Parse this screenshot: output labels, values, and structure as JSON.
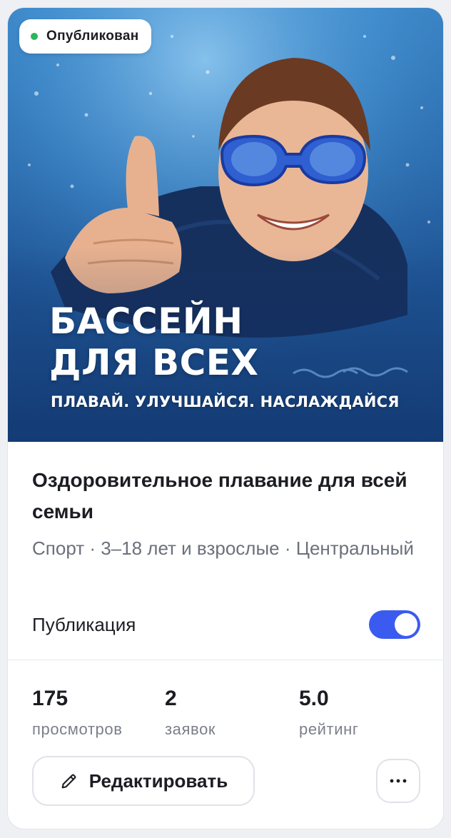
{
  "status_badge": {
    "label": "Опубликован",
    "color": "#2fb45a"
  },
  "hero": {
    "headline_line1": "БАССЕЙН",
    "headline_line2": "ДЛЯ ВСЕХ",
    "subtitle": "ПЛАВАЙ. УЛУЧШАЙСЯ. НАСЛАЖДАЙСЯ"
  },
  "listing": {
    "title": "Оздоровительное плавание для всей семьи",
    "meta": "Спорт · 3–18 лет и взрослые · Центральный"
  },
  "publication": {
    "label": "Публикация",
    "enabled": true,
    "accent": "#3b5bf0"
  },
  "stats": [
    {
      "value": "175",
      "label": "просмотров"
    },
    {
      "value": "2",
      "label": "заявок"
    },
    {
      "value": "5.0",
      "label": "рейтинг"
    }
  ],
  "actions": {
    "edit_label": "Редактировать",
    "edit_icon": "pencil-icon",
    "more_icon": "more-dots-icon"
  }
}
